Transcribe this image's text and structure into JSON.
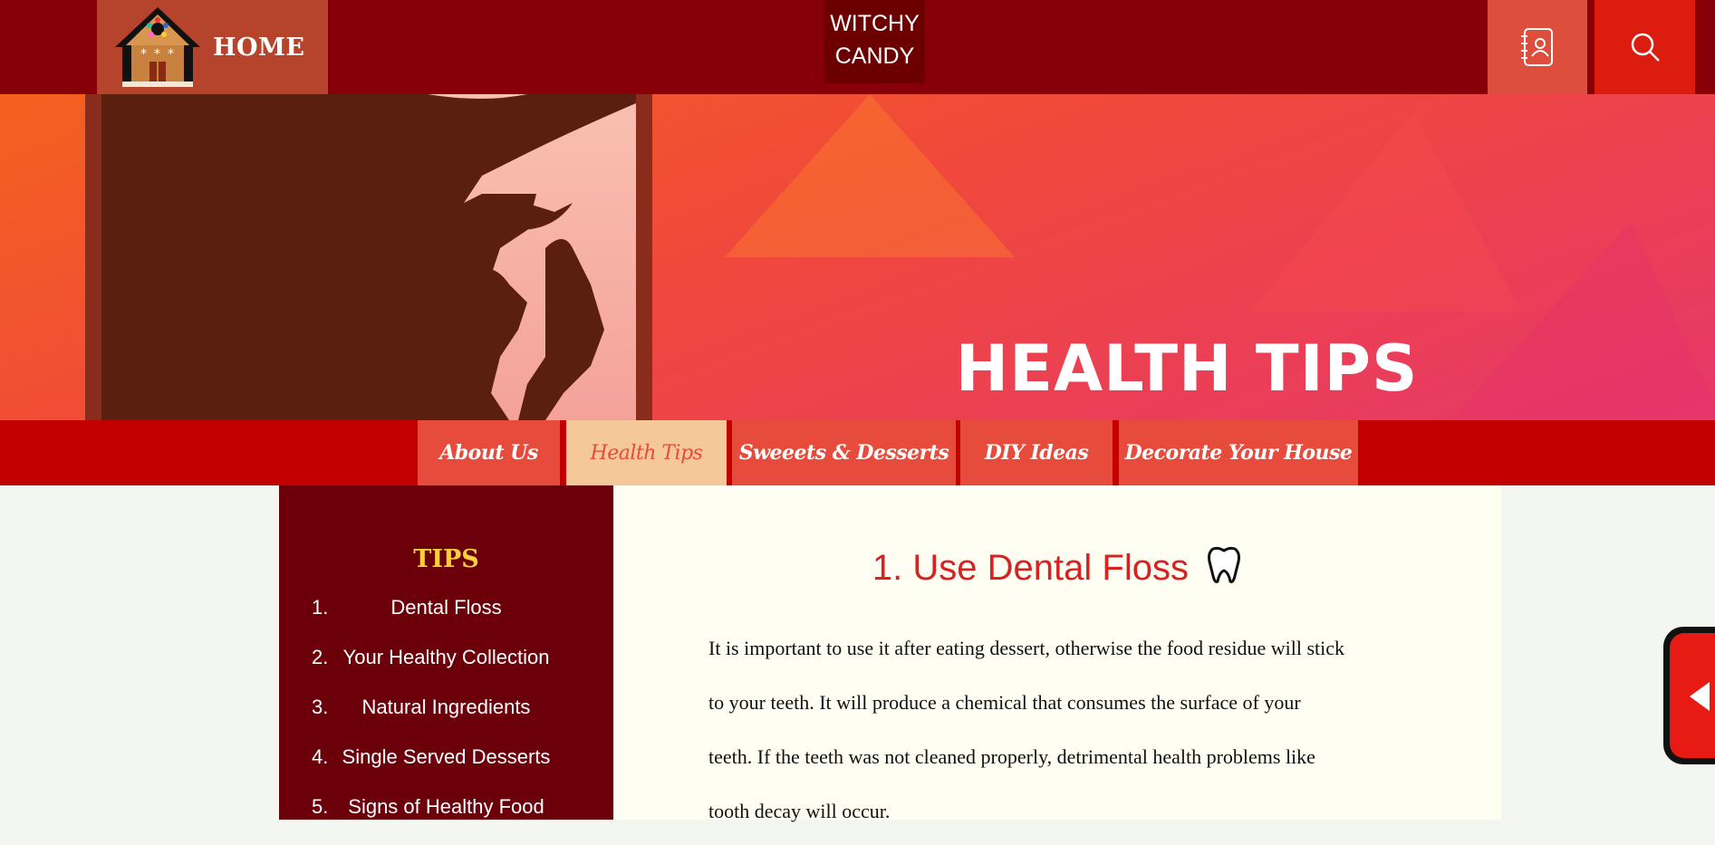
{
  "header": {
    "home_label": "HOME",
    "brand_line1": "WITCHY",
    "brand_line2": "CANDY",
    "contact_icon": "contact-book-icon",
    "search_icon": "search-icon"
  },
  "hero": {
    "title": "HEALTH TIPS"
  },
  "nav": {
    "items": [
      {
        "label": "About Us",
        "active": false
      },
      {
        "label": "Health Tips",
        "active": true
      },
      {
        "label": "Sweeets & Desserts",
        "active": false
      },
      {
        "label": "DIY Ideas",
        "active": false
      },
      {
        "label": "Decorate Your House",
        "active": false
      }
    ]
  },
  "sidebar": {
    "heading": "TIPS",
    "items": [
      {
        "num": "1.",
        "label": "Dental Floss"
      },
      {
        "num": "2.",
        "label": "Your Healthy Collection"
      },
      {
        "num": "3.",
        "label": "Natural Ingredients"
      },
      {
        "num": "4.",
        "label": "Single Served Desserts"
      },
      {
        "num": "5.",
        "label": "Signs of Healthy Food"
      }
    ]
  },
  "article": {
    "title": "1. Use Dental Floss",
    "title_icon": "tooth-icon",
    "line1": "It is important to use it after eating dessert, otherwise the food residue will stick",
    "line2": "to your teeth. It will produce a chemical that consumes the surface of your",
    "line3": "teeth. If the teeth was not cleaned properly, detrimental health problems like",
    "line4": "tooth decay will occur."
  },
  "colors": {
    "topbar": "#870009",
    "nav_bar": "#c30000",
    "nav_item": "#e74b3c",
    "nav_active": "#f5c89a",
    "sidebar": "#6b000b",
    "accent_title": "#d82121",
    "tips_heading": "#f8d03c"
  }
}
